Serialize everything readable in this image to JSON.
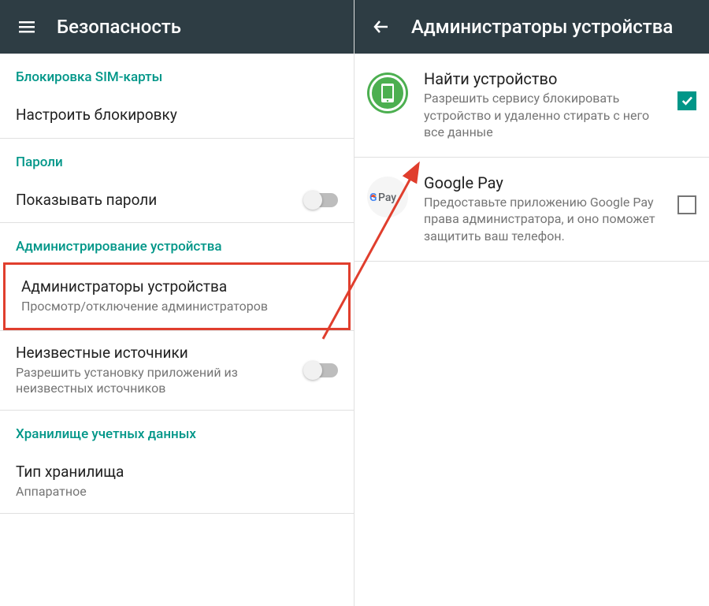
{
  "left_panel": {
    "title": "Безопасность",
    "sections": {
      "sim_lock": {
        "header": "Блокировка SIM-карты",
        "item_label": "Настроить блокировку"
      },
      "passwords": {
        "header": "Пароли",
        "show_passwords_label": "Показывать пароли"
      },
      "device_admin": {
        "header": "Администрирование устройства",
        "admins_title": "Администраторы устройства",
        "admins_subtitle": "Просмотр/отключение администраторов",
        "unknown_sources_title": "Неизвестные источники",
        "unknown_sources_subtitle": "Разрешить установку приложений из неизвестных источников"
      },
      "credentials": {
        "header": "Хранилище учетных данных",
        "storage_type_title": "Тип хранилища",
        "storage_type_value": "Аппаратное"
      }
    }
  },
  "right_panel": {
    "title": "Администраторы устройства",
    "items": [
      {
        "title": "Найти устройство",
        "description": "Разрешить сервису блокировать устройство и удаленно стирать с него все данные",
        "checked": true
      },
      {
        "title": "Google Pay",
        "description": "Предоставьте приложению Google Pay права администратора, и оно поможет защитить ваш телефон.",
        "checked": false
      }
    ]
  },
  "colors": {
    "appbar_bg": "#2e3d44",
    "accent": "#009688",
    "highlight_border": "#e03e2d",
    "arrow": "#e03e2d"
  }
}
